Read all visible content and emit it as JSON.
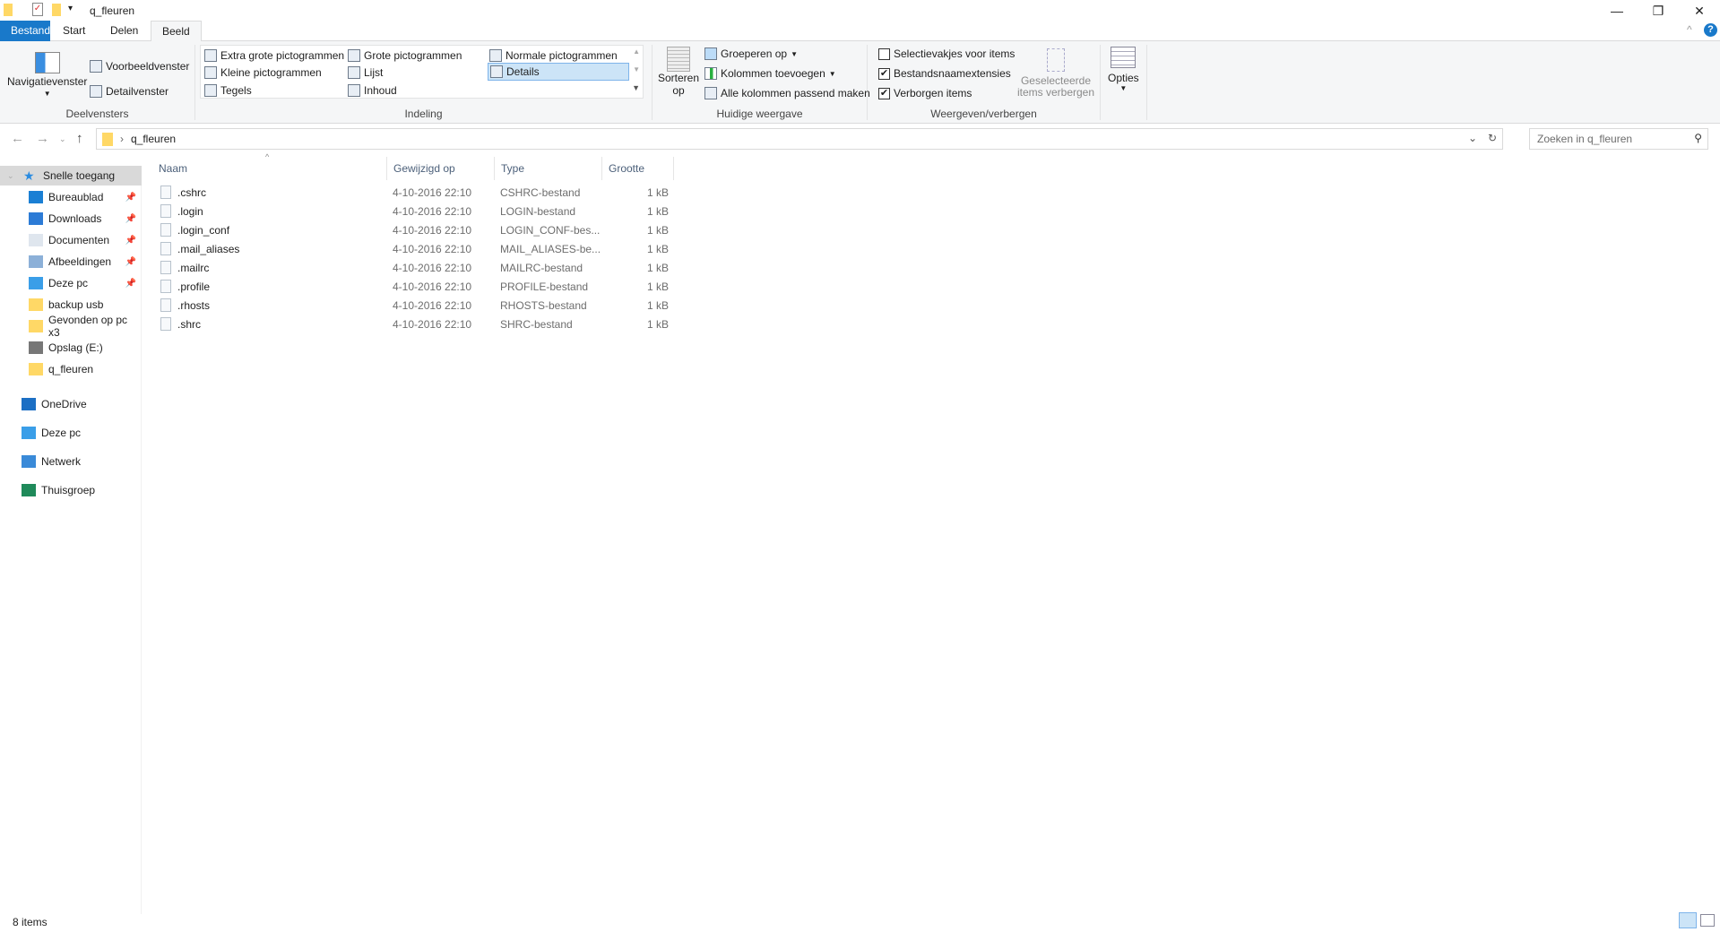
{
  "window": {
    "title": "q_fleuren",
    "minimize": "—",
    "restore": "❐",
    "close": "✕",
    "help": "?",
    "collapse": "^"
  },
  "tabs": [
    "Bestand",
    "Start",
    "Delen",
    "Beeld"
  ],
  "ribbon": {
    "deelvensters": {
      "label": "Deelvensters",
      "nav": "Navigatievenster",
      "preview": "Voorbeeldvenster",
      "detail": "Detailvenster"
    },
    "indeling": {
      "label": "Indeling",
      "items": [
        "Extra grote pictogrammen",
        "Grote pictogrammen",
        "Normale pictogrammen",
        "Kleine pictogrammen",
        "Lijst",
        "Details",
        "Tegels",
        "Inhoud"
      ],
      "selected": "Details"
    },
    "huidige": {
      "label": "Huidige weergave",
      "sort": "Sorteren",
      "sort2": "op",
      "group": "Groeperen op",
      "addcols": "Kolommen toevoegen",
      "fit": "Alle kolommen passend maken"
    },
    "weergeven": {
      "label": "Weergeven/verbergen",
      "checks": [
        {
          "label": "Selectievakjes voor items",
          "checked": false
        },
        {
          "label": "Bestandsnaamextensies",
          "checked": true
        },
        {
          "label": "Verborgen items",
          "checked": true
        }
      ],
      "hide1": "Geselecteerde",
      "hide2": "items verbergen"
    },
    "options": "Opties"
  },
  "address": {
    "path": "q_fleuren",
    "search_placeholder": "Zoeken in q_fleuren"
  },
  "sidebar": {
    "quick": "Snelle toegang",
    "items": [
      {
        "label": "Bureaublad",
        "pinned": true,
        "color": "#1a7fd4"
      },
      {
        "label": "Downloads",
        "pinned": true,
        "color": "#2c7bd6"
      },
      {
        "label": "Documenten",
        "pinned": true,
        "color": "#dfe6ee"
      },
      {
        "label": "Afbeeldingen",
        "pinned": true,
        "color": "#8cb0d8"
      },
      {
        "label": "Deze pc",
        "pinned": true,
        "color": "#3a9ee8"
      },
      {
        "label": "backup usb",
        "pinned": false,
        "color": "#ffd866"
      },
      {
        "label": "Gevonden op pc x3",
        "pinned": false,
        "color": "#ffd866"
      },
      {
        "label": "Opslag (E:)",
        "pinned": false,
        "color": "#777"
      },
      {
        "label": "q_fleuren",
        "pinned": false,
        "color": "#ffd866"
      }
    ],
    "roots": [
      {
        "label": "OneDrive",
        "color": "#1c6fc4"
      },
      {
        "label": "Deze pc",
        "color": "#3a9ee8"
      },
      {
        "label": "Netwerk",
        "color": "#3a8ad8"
      },
      {
        "label": "Thuisgroep",
        "color": "#1f8a5a"
      }
    ]
  },
  "columns": [
    "Naam",
    "Gewijzigd op",
    "Type",
    "Grootte"
  ],
  "files": [
    {
      "name": ".cshrc",
      "date": "4-10-2016 22:10",
      "type": "CSHRC-bestand",
      "size": "1 kB"
    },
    {
      "name": ".login",
      "date": "4-10-2016 22:10",
      "type": "LOGIN-bestand",
      "size": "1 kB"
    },
    {
      "name": ".login_conf",
      "date": "4-10-2016 22:10",
      "type": "LOGIN_CONF-bes...",
      "size": "1 kB"
    },
    {
      "name": ".mail_aliases",
      "date": "4-10-2016 22:10",
      "type": "MAIL_ALIASES-be...",
      "size": "1 kB"
    },
    {
      "name": ".mailrc",
      "date": "4-10-2016 22:10",
      "type": "MAILRC-bestand",
      "size": "1 kB"
    },
    {
      "name": ".profile",
      "date": "4-10-2016 22:10",
      "type": "PROFILE-bestand",
      "size": "1 kB"
    },
    {
      "name": ".rhosts",
      "date": "4-10-2016 22:10",
      "type": "RHOSTS-bestand",
      "size": "1 kB"
    },
    {
      "name": ".shrc",
      "date": "4-10-2016 22:10",
      "type": "SHRC-bestand",
      "size": "1 kB"
    }
  ],
  "status": {
    "count": "8 items"
  }
}
